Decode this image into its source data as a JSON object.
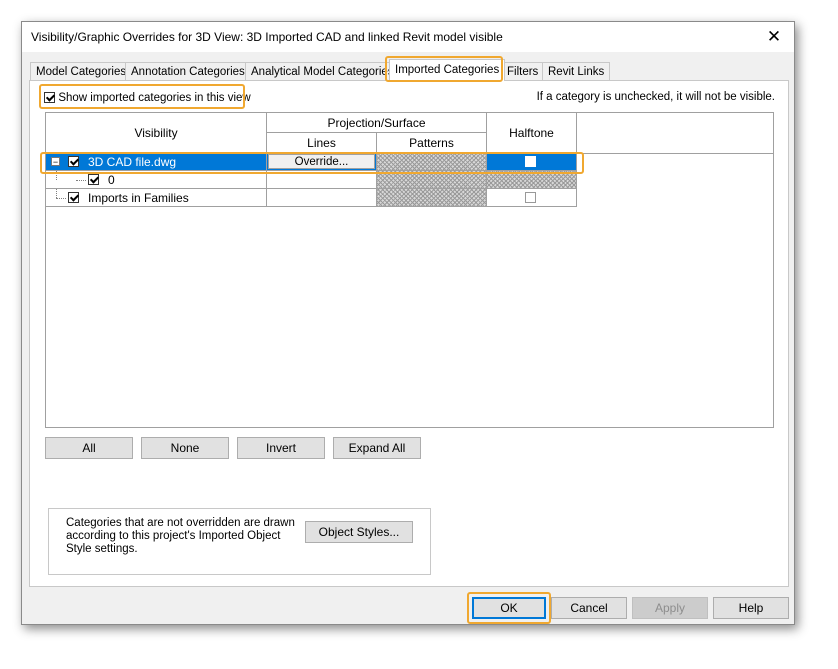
{
  "window": {
    "title": "Visibility/Graphic Overrides for 3D View: 3D Imported CAD and linked Revit model visible",
    "close_glyph": "✕"
  },
  "tabs": [
    {
      "label": "Model Categories"
    },
    {
      "label": "Annotation Categories"
    },
    {
      "label": "Analytical Model Categories"
    },
    {
      "label": "Imported Categories"
    },
    {
      "label": "Filters"
    },
    {
      "label": "Revit Links"
    }
  ],
  "active_tab": "Imported Categories",
  "show_imported": {
    "label": "Show imported categories in this view",
    "checked": true
  },
  "hint": "If a category is unchecked, it will not be visible.",
  "table": {
    "headers": {
      "visibility": "Visibility",
      "projection_surface": "Projection/Surface",
      "lines": "Lines",
      "patterns": "Patterns",
      "halftone": "Halftone"
    },
    "rows": [
      {
        "name": "3D CAD file.dwg",
        "checked": true,
        "expanded": true,
        "selected": true,
        "lines": "Override...",
        "halftone": false
      },
      {
        "name": "0",
        "checked": true,
        "child": true,
        "lines": "",
        "halftone": null
      },
      {
        "name": "Imports in Families",
        "checked": true,
        "lines": "",
        "halftone": false
      }
    ],
    "expander_glyph": "−"
  },
  "grid_buttons": {
    "all": "All",
    "none": "None",
    "invert": "Invert",
    "expand_all": "Expand All"
  },
  "info": {
    "text": "Categories that are not overridden are drawn according to this project's Imported Object Style settings.",
    "object_styles": "Object Styles..."
  },
  "footer": {
    "ok": "OK",
    "cancel": "Cancel",
    "apply": "Apply",
    "help": "Help"
  },
  "colors": {
    "accent_highlight": "#f0a830",
    "selection": "#0078d7"
  }
}
